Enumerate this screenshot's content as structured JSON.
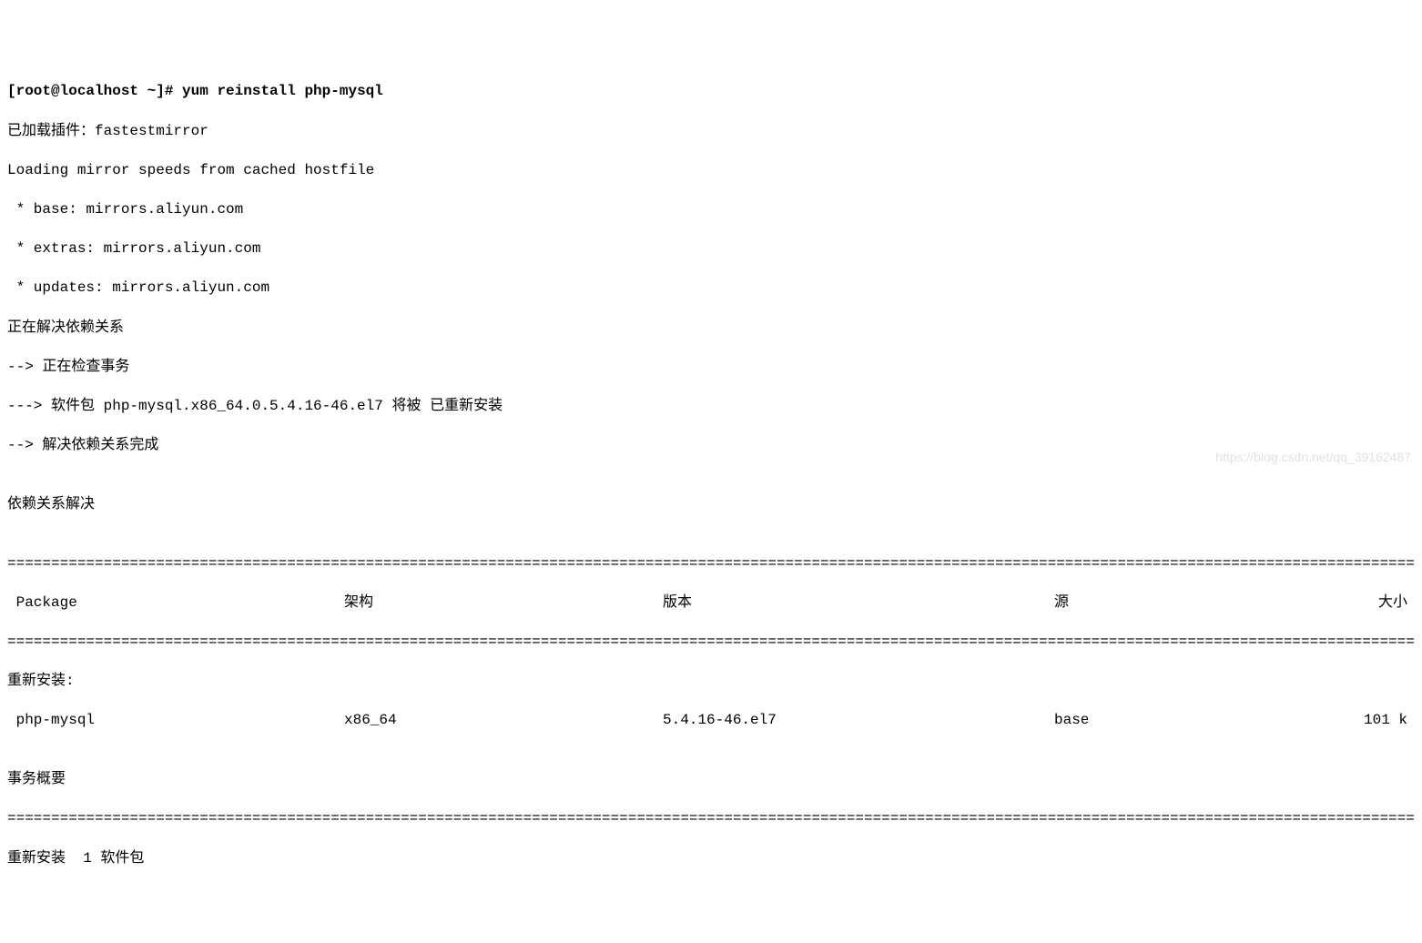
{
  "prompt": "[root@localhost ~]# ",
  "command": "yum reinstall php-mysql",
  "lines": {
    "plugins": "已加载插件：fastestmirror",
    "loading": "Loading mirror speeds from cached hostfile",
    "mirror_base": " * base: mirrors.aliyun.com",
    "mirror_extras": " * extras: mirrors.aliyun.com",
    "mirror_updates": " * updates: mirrors.aliyun.com",
    "resolving": "正在解决依赖关系",
    "checking": "--> 正在检查事务",
    "pkg_action": "---> 软件包 php-mysql.x86_64.0.5.4.16-46.el7 将被 已重新安装",
    "done": "--> 解决依赖关系完成",
    "blank": "",
    "dep_resolved": "依赖关系解决"
  },
  "hr": "============================================================================================================================================================================================================================================",
  "table": {
    "headers": {
      "package": " Package",
      "arch": "架构",
      "version": "版本",
      "repo": "源",
      "size": "大小"
    },
    "section_label": "重新安装:",
    "rows": [
      {
        "package": " php-mysql",
        "arch": "x86_64",
        "version": "5.4.16-46.el7",
        "repo": "base",
        "size": "101 k"
      }
    ]
  },
  "summary": {
    "title": "事务概要",
    "line": "重新安装  1 软件包"
  },
  "watermark": "https://blog.csdn.net/qq_39162487"
}
